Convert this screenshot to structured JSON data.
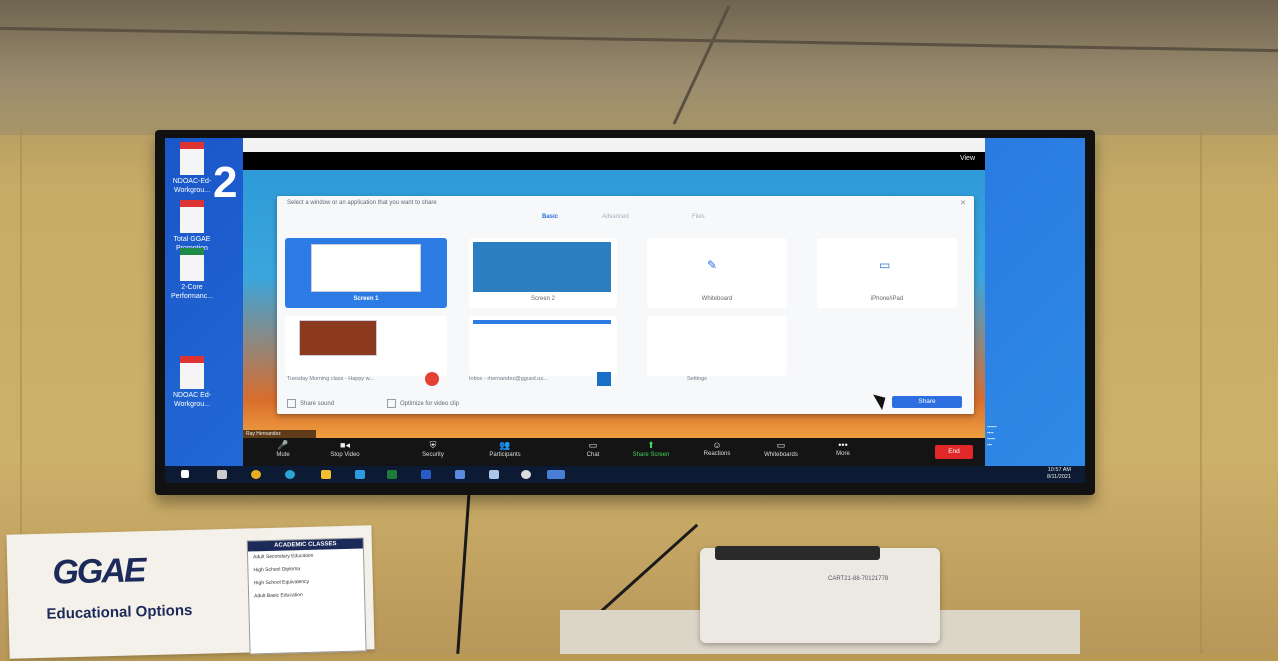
{
  "desktop": {
    "icons": [
      {
        "label": "NDOAC-Ed-Workgrou..."
      },
      {
        "label": "Total GGAE Promotion"
      },
      {
        "label": "2-Core Performanc..."
      },
      {
        "label": "NDOAC Ed-Workgrou..."
      }
    ],
    "big_number": "2"
  },
  "zoom": {
    "view_label": "View",
    "dialog_title": "Select a window or an application that you want to share",
    "tabs": [
      "Basic",
      "Advanced",
      "Files"
    ],
    "options": [
      {
        "label": "Screen 1",
        "selected": true
      },
      {
        "label": "Screen 2",
        "selected": false
      },
      {
        "label": "Whiteboard",
        "selected": false
      },
      {
        "label": "iPhone/iPad",
        "selected": false
      }
    ],
    "windows": [
      {
        "label": "Tuesday Morning class - Happy w..."
      },
      {
        "label": "Inbox - rhernandez@ggusd.us..."
      },
      {
        "label": "Settings"
      }
    ],
    "share_sound": "Share sound",
    "optimize": "Optimize for video clip",
    "share_button": "Share",
    "participant_name": "Ray Hernandez",
    "toolbar": [
      {
        "label": "Mute",
        "icon": "mic-icon"
      },
      {
        "label": "Stop Video",
        "icon": "video-icon"
      },
      {
        "label": "Security",
        "icon": "shield-icon"
      },
      {
        "label": "Participants",
        "icon": "people-icon"
      },
      {
        "label": "Chat",
        "icon": "chat-icon"
      },
      {
        "label": "Share Screen",
        "icon": "share-icon"
      },
      {
        "label": "Reactions",
        "icon": "smile-icon"
      },
      {
        "label": "Whiteboards",
        "icon": "whiteboard-icon"
      },
      {
        "label": "More",
        "icon": "more-icon"
      }
    ],
    "end_button": "End"
  },
  "taskbar": {
    "time": "10:57 AM",
    "date": "8/11/2021"
  },
  "poster": {
    "logo": "GGAE",
    "subtitle": "Educational Options",
    "panel_header": "ACADEMIC CLASSES",
    "panel_lines": [
      "Adult Secondary Education",
      "High School Diploma",
      "High School Equivalency",
      "Adult Basic Education"
    ]
  },
  "printer": {
    "label": "CART21-88-70121778"
  }
}
